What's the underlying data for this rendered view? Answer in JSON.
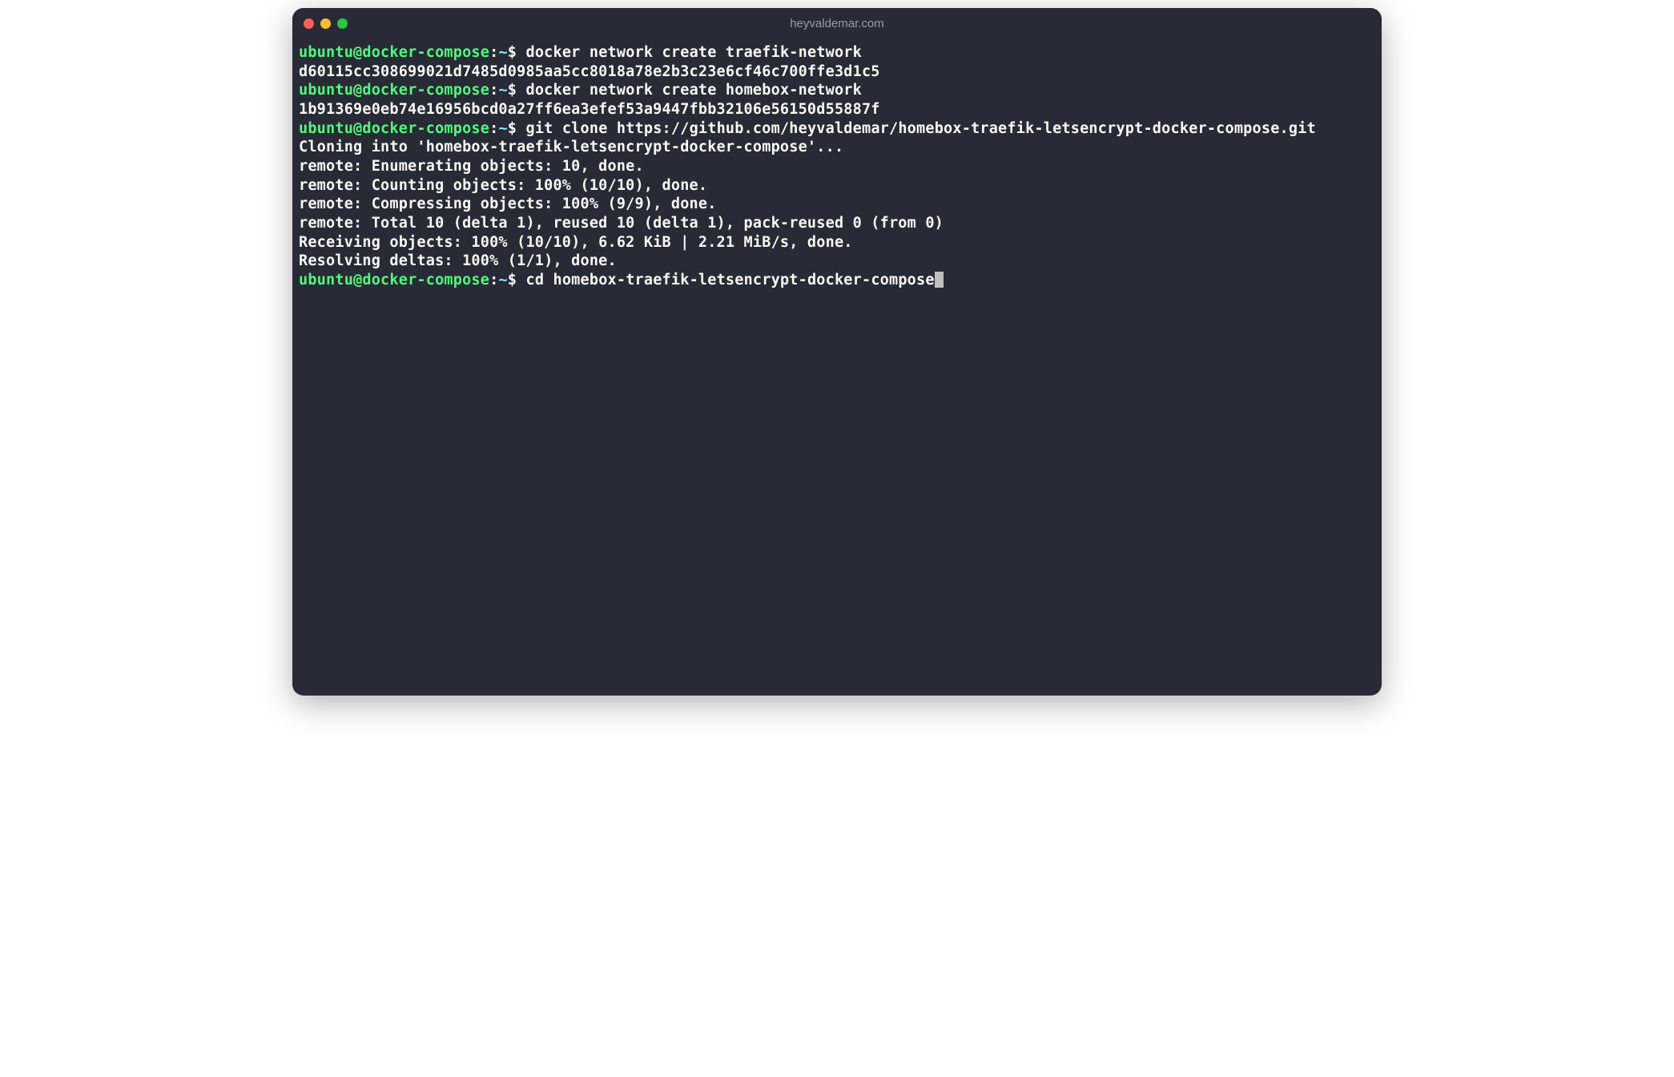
{
  "titlebar": {
    "title": "heyvaldemar.com"
  },
  "prompt": {
    "user": "ubuntu",
    "at": "@",
    "host": "docker-compose",
    "colon": ":",
    "path": "~",
    "dollar": "$"
  },
  "lines": [
    {
      "type": "prompt",
      "cmd": "docker network create traefik-network"
    },
    {
      "type": "output",
      "text": "d60115cc308699021d7485d0985aa5cc8018a78e2b3c23e6cf46c700ffe3d1c5"
    },
    {
      "type": "prompt",
      "cmd": "docker network create homebox-network"
    },
    {
      "type": "output",
      "text": "1b91369e0eb74e16956bcd0a27ff6ea3efef53a9447fbb32106e56150d55887f"
    },
    {
      "type": "prompt",
      "cmd": "git clone https://github.com/heyvaldemar/homebox-traefik-letsencrypt-docker-compose.git"
    },
    {
      "type": "output",
      "text": "Cloning into 'homebox-traefik-letsencrypt-docker-compose'..."
    },
    {
      "type": "output",
      "text": "remote: Enumerating objects: 10, done."
    },
    {
      "type": "output",
      "text": "remote: Counting objects: 100% (10/10), done."
    },
    {
      "type": "output",
      "text": "remote: Compressing objects: 100% (9/9), done."
    },
    {
      "type": "output",
      "text": "remote: Total 10 (delta 1), reused 10 (delta 1), pack-reused 0 (from 0)"
    },
    {
      "type": "output",
      "text": "Receiving objects: 100% (10/10), 6.62 KiB | 2.21 MiB/s, done."
    },
    {
      "type": "output",
      "text": "Resolving deltas: 100% (1/1), done."
    },
    {
      "type": "prompt",
      "cmd": "cd homebox-traefik-letsencrypt-docker-compose",
      "cursor": true
    }
  ]
}
